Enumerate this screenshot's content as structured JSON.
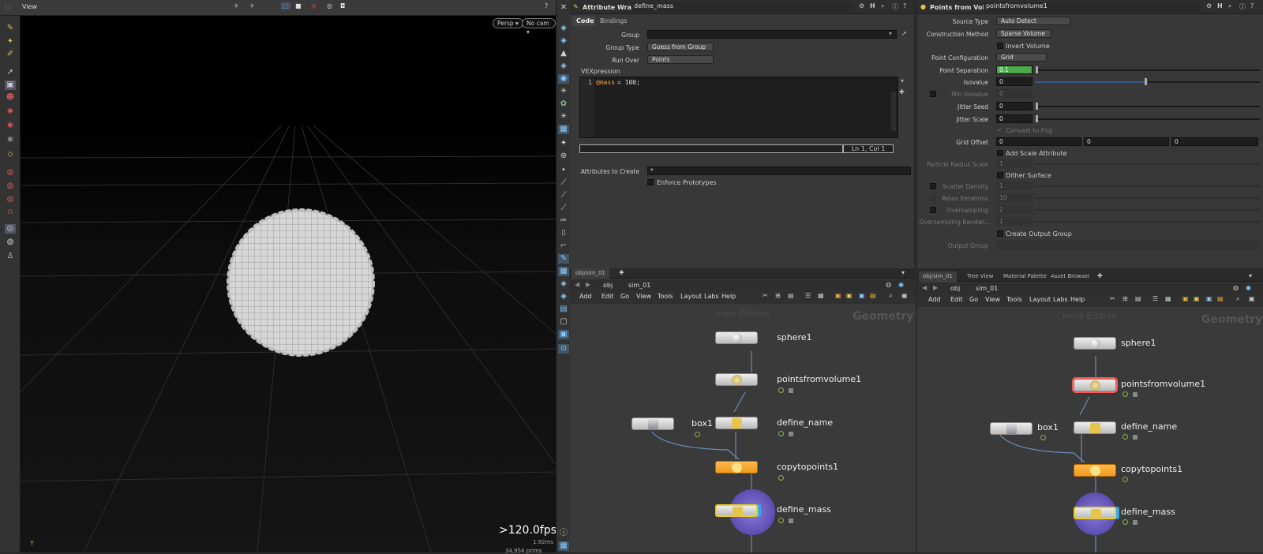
{
  "viewport": {
    "title": "View",
    "persp_label": "Persp ▾",
    "cam_label": "No cam ▾",
    "fps": ">120.0fps",
    "ms": "1.92ms",
    "counts": "34,954  prims",
    "axis_label": "Y"
  },
  "wrangle": {
    "node_type": "Attribute Wrangle",
    "node_name": "define_mass",
    "tabs": [
      "Code",
      "Bindings"
    ],
    "group_label": "Group",
    "group_value": "",
    "group_type_label": "Group Type",
    "group_type_value": "Guess from Group",
    "run_over_label": "Run Over",
    "run_over_value": "Points",
    "vex_label": "VEXpression",
    "line_number": "1",
    "code_var": "@mass",
    "code_rest": " = 100;",
    "cursor_pos": "Ln 1, Col 1",
    "attrs_label": "Attributes to Create",
    "attrs_value": "*",
    "enforce_label": "Enforce Prototypes"
  },
  "pfv": {
    "node_type": "Points from Volume",
    "node_name": "pointsfromvolume1",
    "source_type_label": "Source Type",
    "source_type_value": "Auto Detect",
    "construction_label": "Construction Method",
    "construction_value": "Sparse Volume",
    "invert_label": "Invert Volume",
    "point_config_label": "Point Configuration",
    "point_config_value": "Grid",
    "point_sep_label": "Point Separation",
    "point_sep_value": "0.1",
    "isovalue_label": "Isovalue",
    "isovalue_value": "0",
    "min_isovalue_label": "Min Isovalue",
    "min_isovalue_value": "0",
    "jitter_seed_label": "Jitter Seed",
    "jitter_seed_value": "0",
    "jitter_scale_label": "Jitter Scale",
    "jitter_scale_value": "0",
    "convert_fog_label": "Convert to Fog",
    "grid_offset_label": "Grid Offset",
    "grid_offset_values": [
      "0",
      "0",
      "0"
    ],
    "add_scale_label": "Add Scale Attribute",
    "particle_radius_label": "Particle Radius Scale",
    "particle_radius_value": "1",
    "dither_label": "Dither Surface",
    "scatter_density_label": "Scatter Density",
    "scatter_density_value": "1",
    "relax_label": "Relax Iterations",
    "relax_value": "10",
    "oversampling_label": "Oversampling",
    "oversampling_value": "2",
    "oversampling_bw_label": "Oversampling Bandwi...",
    "oversampling_bw_value": "1",
    "create_group_label": "Create Output Group",
    "output_group_label": "Output Group"
  },
  "net_left": {
    "tab": "obj/sim_01",
    "path_obj": "obj",
    "path_sim": "sim_01",
    "menu": [
      "Add",
      "Edit",
      "Go",
      "View",
      "Tools",
      "Layout",
      "Labs",
      "Help"
    ],
    "edition": "Indie Edition",
    "context": "Geometry"
  },
  "net_right": {
    "tabs": [
      "obj/sim_01",
      "Tree View",
      "Material Palette",
      "Asset Browser"
    ],
    "path_obj": "obj",
    "path_sim": "sim_01",
    "menu": [
      "Add",
      "Edit",
      "Go",
      "View",
      "Tools",
      "Layout",
      "Labs",
      "Help"
    ],
    "edition": "Indie Edition",
    "context": "Geometry"
  },
  "nodes": {
    "sphere": "sphere1",
    "pfv": "pointsfromvolume1",
    "define_name": "define_name",
    "box": "box1",
    "copytopoints": "copytopoints1",
    "define_mass": "define_mass"
  }
}
